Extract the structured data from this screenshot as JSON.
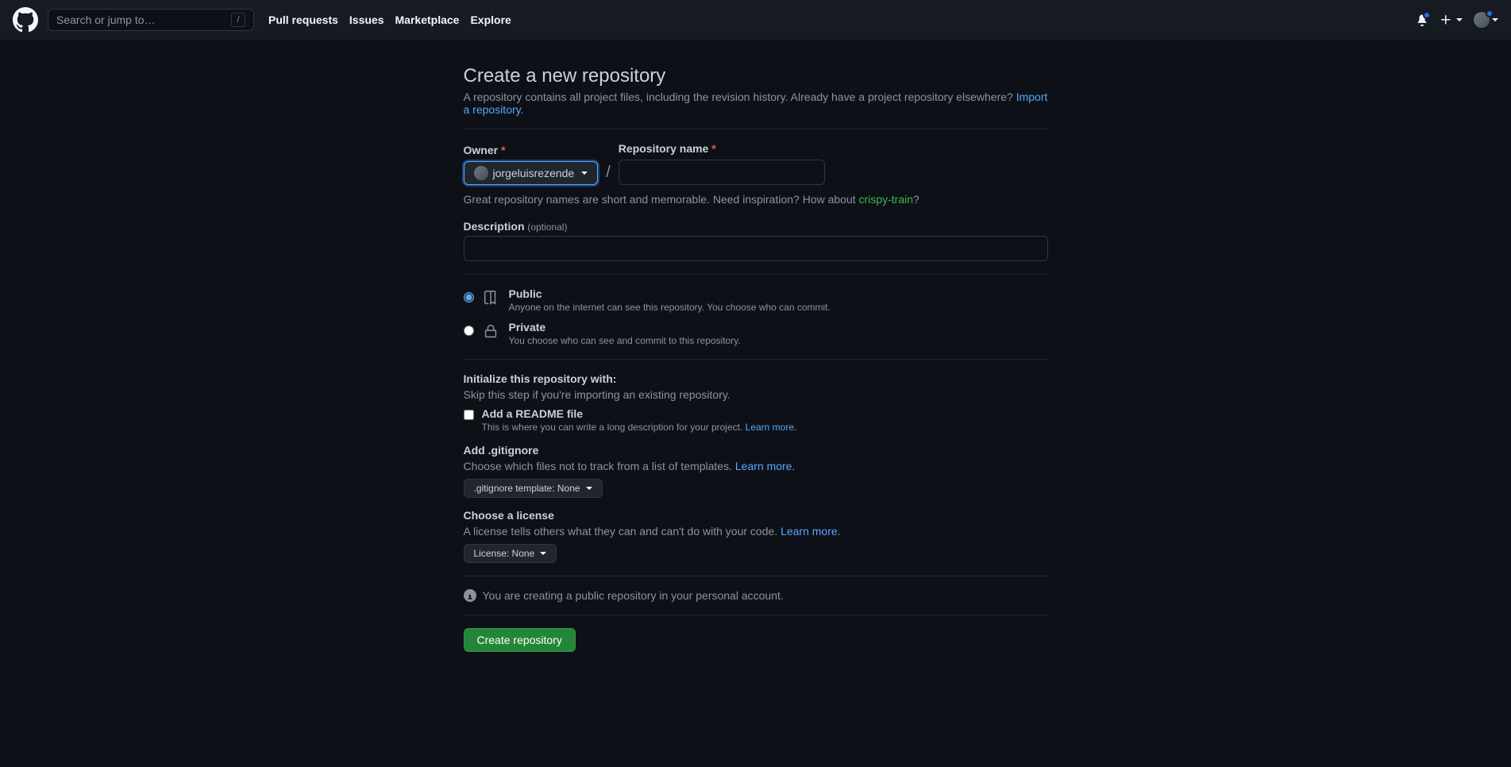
{
  "header": {
    "search_placeholder": "Search or jump to…",
    "nav": [
      "Pull requests",
      "Issues",
      "Marketplace",
      "Explore"
    ]
  },
  "page": {
    "title": "Create a new repository",
    "subtitle": "A repository contains all project files, including the revision history. Already have a project repository elsewhere?",
    "import_link": "Import a repository."
  },
  "owner": {
    "label": "Owner",
    "value": "jorgeluisrezende"
  },
  "repo_name": {
    "label": "Repository name"
  },
  "suggestion": {
    "prefix": "Great repository names are short and memorable. Need inspiration? How about ",
    "name": "crispy-train",
    "suffix": "?"
  },
  "description": {
    "label": "Description",
    "optional": "(optional)"
  },
  "visibility": {
    "public": {
      "title": "Public",
      "sub": "Anyone on the internet can see this repository. You choose who can commit."
    },
    "private": {
      "title": "Private",
      "sub": "You choose who can see and commit to this repository."
    }
  },
  "init": {
    "heading": "Initialize this repository with:",
    "skip": "Skip this step if you're importing an existing repository.",
    "readme": {
      "title": "Add a README file",
      "sub": "This is where you can write a long description for your project. ",
      "learn": "Learn more."
    },
    "gitignore": {
      "title": "Add .gitignore",
      "sub": "Choose which files not to track from a list of templates. ",
      "learn": "Learn more.",
      "button": ".gitignore template: None"
    },
    "license": {
      "title": "Choose a license",
      "sub": "A license tells others what they can and can't do with your code. ",
      "learn": "Learn more.",
      "button": "License: None"
    }
  },
  "info_line": "You are creating a public repository in your personal account.",
  "submit": "Create repository"
}
